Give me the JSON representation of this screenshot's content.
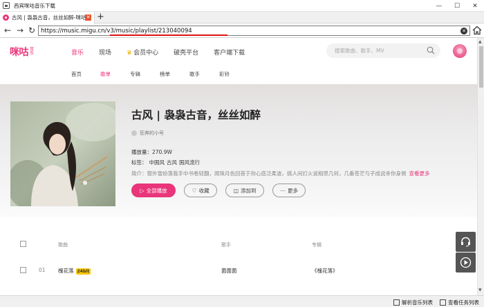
{
  "window": {
    "title": "西宾咪咕音乐下载",
    "controls": [
      "minimize",
      "maximize",
      "close"
    ]
  },
  "tab": {
    "label": "古风 | 袅袅古音，丝丝如醉-咪咕...",
    "new_tab": "+"
  },
  "address": {
    "url": "https://music.migu.cn/v3/music/playlist/213040094"
  },
  "site": {
    "logo_text": "咪咕",
    "logo_sub": "音乐",
    "nav": [
      "音乐",
      "现场",
      "会员中心",
      "破壳平台",
      "客户端下载"
    ],
    "search_placeholder": "搜索歌曲、歌手、MV",
    "subnav": [
      "首页",
      "歌单",
      "专辑",
      "榜单",
      "歌手",
      "彩铃"
    ]
  },
  "playlist": {
    "title": "古风 | 袅袅古音，丝丝如醉",
    "creator": "狂奔的小号",
    "play_count_label": "播放量：",
    "play_count": "270.9W",
    "tags_label": "标签：",
    "tags": [
      "中国风",
      "古风",
      "国风流行"
    ],
    "intro": "简介：窗外雪纷落我手中书卷轻翻，闻珠月色回首于你心底泛柔波，挑人间灯火说相思几何，几番苍茫与子成说幸你身侧",
    "more_label": "查看更多",
    "buttons": {
      "play_all": "全部播放",
      "collect": "收藏",
      "add_to": "添加到",
      "more": "更多"
    }
  },
  "table": {
    "headers": {
      "song": "歌曲",
      "singer": "歌手",
      "album": "专辑"
    },
    "rows": [
      {
        "index": "01",
        "song": "槐花落",
        "badge": "24bit",
        "singer": "菌菌菌",
        "album": "《槐花落》"
      }
    ]
  },
  "statusbar": {
    "parse_list": "解析音乐列表",
    "task_list": "查看任务列表"
  },
  "colors": {
    "accent": "#e9357a"
  }
}
